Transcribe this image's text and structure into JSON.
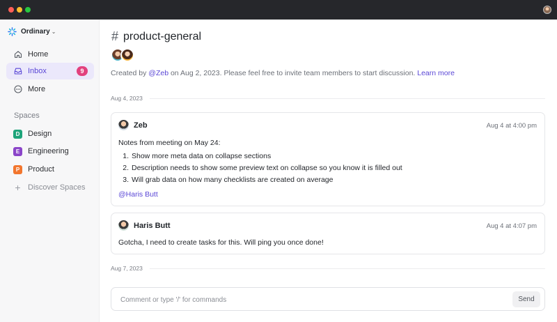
{
  "window": {
    "title_bar_buttons": [
      "close",
      "minimize",
      "zoom"
    ]
  },
  "sidebar": {
    "workspace_name": "Ordinary",
    "nav": [
      {
        "label": "Home",
        "icon": "home-icon"
      },
      {
        "label": "Inbox",
        "icon": "inbox-icon",
        "badge": "9",
        "active": true
      },
      {
        "label": "More",
        "icon": "more-icon"
      }
    ],
    "spaces_title": "Spaces",
    "spaces": [
      {
        "label": "Design",
        "letter": "D",
        "color": "#1ea47a"
      },
      {
        "label": "Engineering",
        "letter": "E",
        "color": "#8b45c9"
      },
      {
        "label": "Product",
        "letter": "P",
        "color": "#f2762e"
      }
    ],
    "discover_label": "Discover Spaces"
  },
  "channel": {
    "name": "product-general",
    "created_prefix": "Created by ",
    "created_by": "@Zeb",
    "created_suffix": " on Aug 2, 2023. Please feel free to invite team members to start discussion. ",
    "learn_more": "Learn more"
  },
  "messages": {
    "date_1": "Aug 4, 2023",
    "date_2": "Aug 7, 2023",
    "msg1": {
      "author": "Zeb",
      "time": "Aug 4 at 4:00 pm",
      "intro": "Notes from meeting on May 24:",
      "items": [
        {
          "n": "1.",
          "text": "Show more meta data on collapse sections"
        },
        {
          "n": "2.",
          "text": "Description needs to show some preview text on collapse so you know it is filled out"
        },
        {
          "n": "3.",
          "text": "Will grab data on how many checklists are created on average"
        }
      ],
      "mention": "@Haris Butt"
    },
    "msg2": {
      "author": "Haris Butt",
      "time": "Aug 4 at 4:07 pm",
      "text": "Gotcha, I need to create tasks for this. Will ping you once done!"
    }
  },
  "composer": {
    "placeholder": "Comment or type '/' for commands",
    "value": "",
    "send_label": "Send"
  },
  "colors": {
    "accent": "#5a47d6",
    "badge": "#e2417e",
    "active_bg": "#ebe8fb"
  }
}
